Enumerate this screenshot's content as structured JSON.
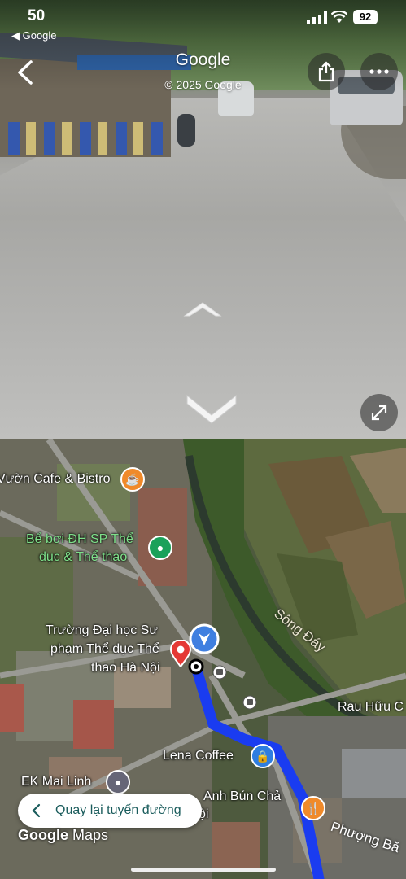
{
  "status_bar": {
    "time": "50",
    "back_app": "◀ Google",
    "battery": "92"
  },
  "street_view": {
    "title": "Google",
    "copyright": "© 2025 Google"
  },
  "map": {
    "labels": {
      "cafe": "Vườn Cafe & Bistro",
      "pool_line1": "Bể bơi ĐH SP Thể",
      "pool_line2": "dục & Thể thao",
      "university_line1": "Trường Đại học Sư",
      "university_line2": "phạm Thể dục Thể",
      "university_line3": "thao Hà Nội",
      "river": "Sông Đáy",
      "rau": "Rau Hữu C",
      "lena": "Lena Coffee",
      "ek": "EK Mai Linh",
      "bun_line1": "Anh Bún Chả",
      "bun_line2": "ội",
      "street": "Phượng Bă"
    },
    "route_button": "Quay lại tuyến đường",
    "logo_google": "Google",
    "logo_maps": "Maps"
  },
  "colors": {
    "route": "#1a3cf0",
    "accent_teal": "#1a5c5c"
  }
}
